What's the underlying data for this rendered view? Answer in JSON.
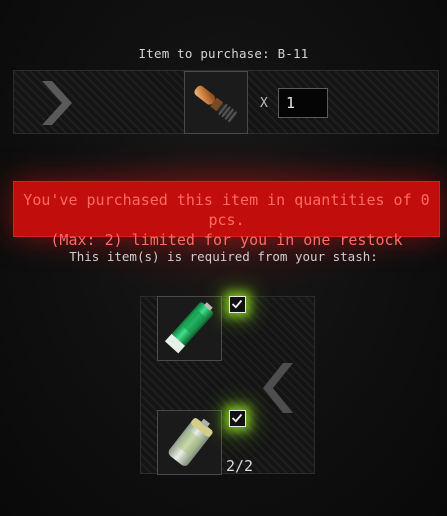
{
  "purchase": {
    "title": "Item to purchase: B-11",
    "item_name": "B-11",
    "multiply_sign": "X",
    "quantity": "1"
  },
  "warning": {
    "line1": "You've purchased this item in quantities of 0 pcs.",
    "line2": "(Max: 2) limited for you in one restock"
  },
  "requirements": {
    "label": "This item(s) is required from your stash:",
    "items": [
      {
        "icon": "green-battery-icon",
        "checked": true
      },
      {
        "icon": "white-battery-icon",
        "checked": true
      }
    ],
    "count": "2/2"
  },
  "colors": {
    "warning_bg": "#c20d0d",
    "warning_text": "#ff6b62",
    "check_glow": "#96e628"
  }
}
